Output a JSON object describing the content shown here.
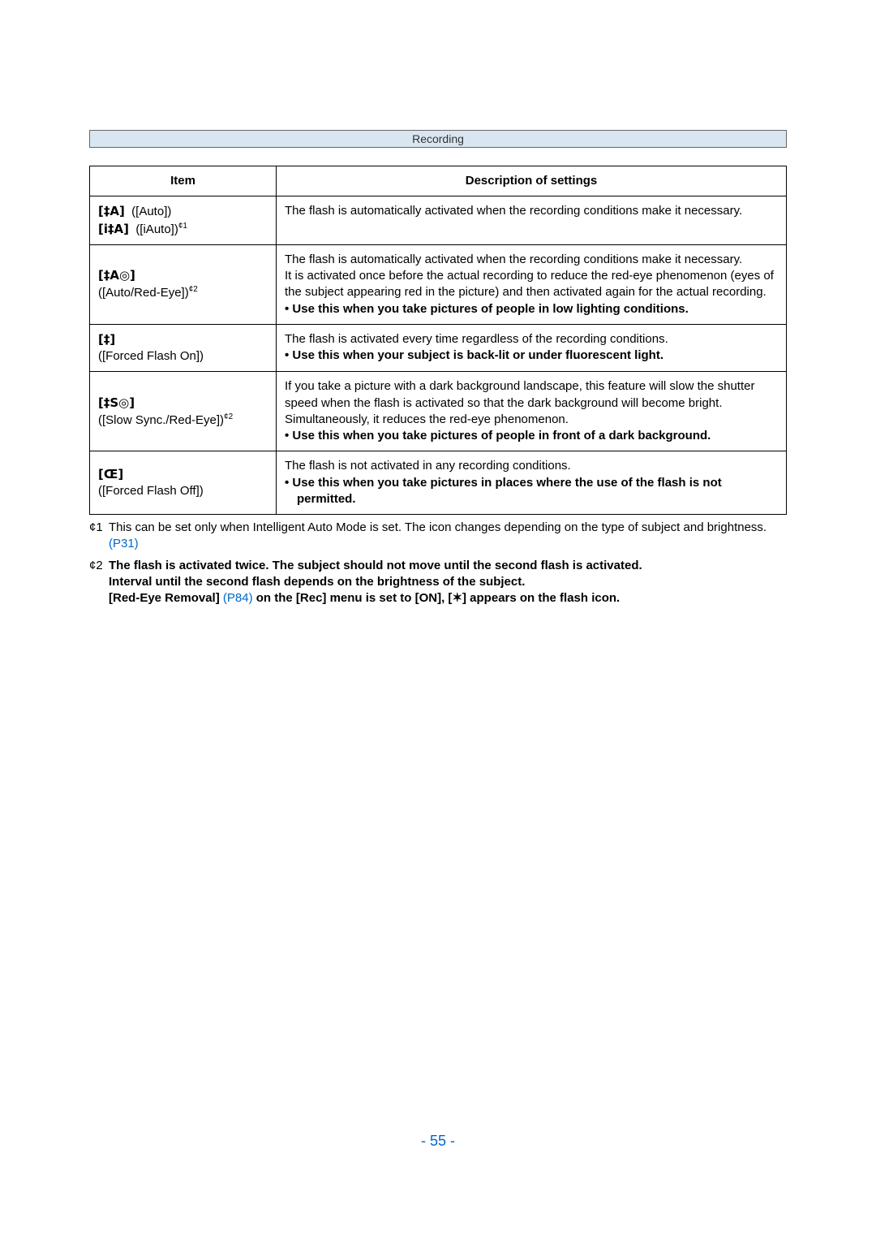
{
  "header": {
    "section": "Recording"
  },
  "table": {
    "col1": "Item",
    "col2": "Description of settings",
    "rows": [
      {
        "item_lines": [
          {
            "icon": "[‡A]",
            "label": "([Auto])",
            "sup": ""
          },
          {
            "icon": "[i‡A]",
            "label": "([iAuto])",
            "sup": "¢1"
          }
        ],
        "desc": "The flash is automatically activated when the recording conditions make it necessary."
      },
      {
        "item_lines": [
          {
            "icon": "[‡A◎]",
            "label": "",
            "sup": ""
          },
          {
            "icon_plain": "([Auto/Red-Eye])",
            "sup": "¢2"
          }
        ],
        "desc": "The flash is automatically activated when the recording conditions make it necessary.\nIt is activated once before the actual recording to reduce the red-eye phenomenon (eyes of the subject appearing red in the picture) and then activated again for the actual recording.",
        "bullet": "Use this when you take pictures of people in low lighting conditions."
      },
      {
        "item_lines": [
          {
            "icon": "[‡]",
            "label": "",
            "sup": ""
          },
          {
            "icon_plain": "([Forced Flash On])",
            "sup": ""
          }
        ],
        "desc": "The flash is activated every time regardless of the recording conditions.",
        "bullet": "Use this when your subject is back-lit or under fluorescent light."
      },
      {
        "item_lines": [
          {
            "icon": "[‡S◎]",
            "label": "",
            "sup": ""
          },
          {
            "icon_plain": "([Slow Sync./Red-Eye])",
            "sup": "¢2"
          }
        ],
        "desc": "If you take a picture with a dark background landscape, this feature will slow the shutter speed when the flash is activated so that the dark background will become bright. Simultaneously, it reduces the red-eye phenomenon.",
        "bullet": "Use this when you take pictures of people in front of a dark background."
      },
      {
        "item_lines": [
          {
            "icon": "[Œ]",
            "label": "",
            "sup": ""
          },
          {
            "icon_plain": "([Forced Flash Off])",
            "sup": ""
          }
        ],
        "desc": "The flash is not activated in any recording conditions.",
        "bullet": "Use this when you take pictures in places where the use of the flash is not permitted."
      }
    ]
  },
  "footnotes": {
    "f1_num": "¢1",
    "f1_text_a": "This can be set only when Intelligent Auto Mode is set. The icon changes depending on the type of subject and brightness.",
    "f1_link": " (P31)",
    "f2_num": "¢2",
    "f2_line1": "The flash is activated twice. The subject should not move until the second flash is activated.",
    "f2_line2_a": "Interval until the second flash depends on the brightness of the subject.",
    "f2_line3_a": "[Red-Eye Removal]",
    "f2_line3_link": " (P84)",
    "f2_line3_b": " on the [Rec] menu is set to [ON], [",
    "f2_line3_icon": "✶",
    "f2_line3_c": "] appears on the flash icon."
  },
  "page_number": "- 55 -"
}
